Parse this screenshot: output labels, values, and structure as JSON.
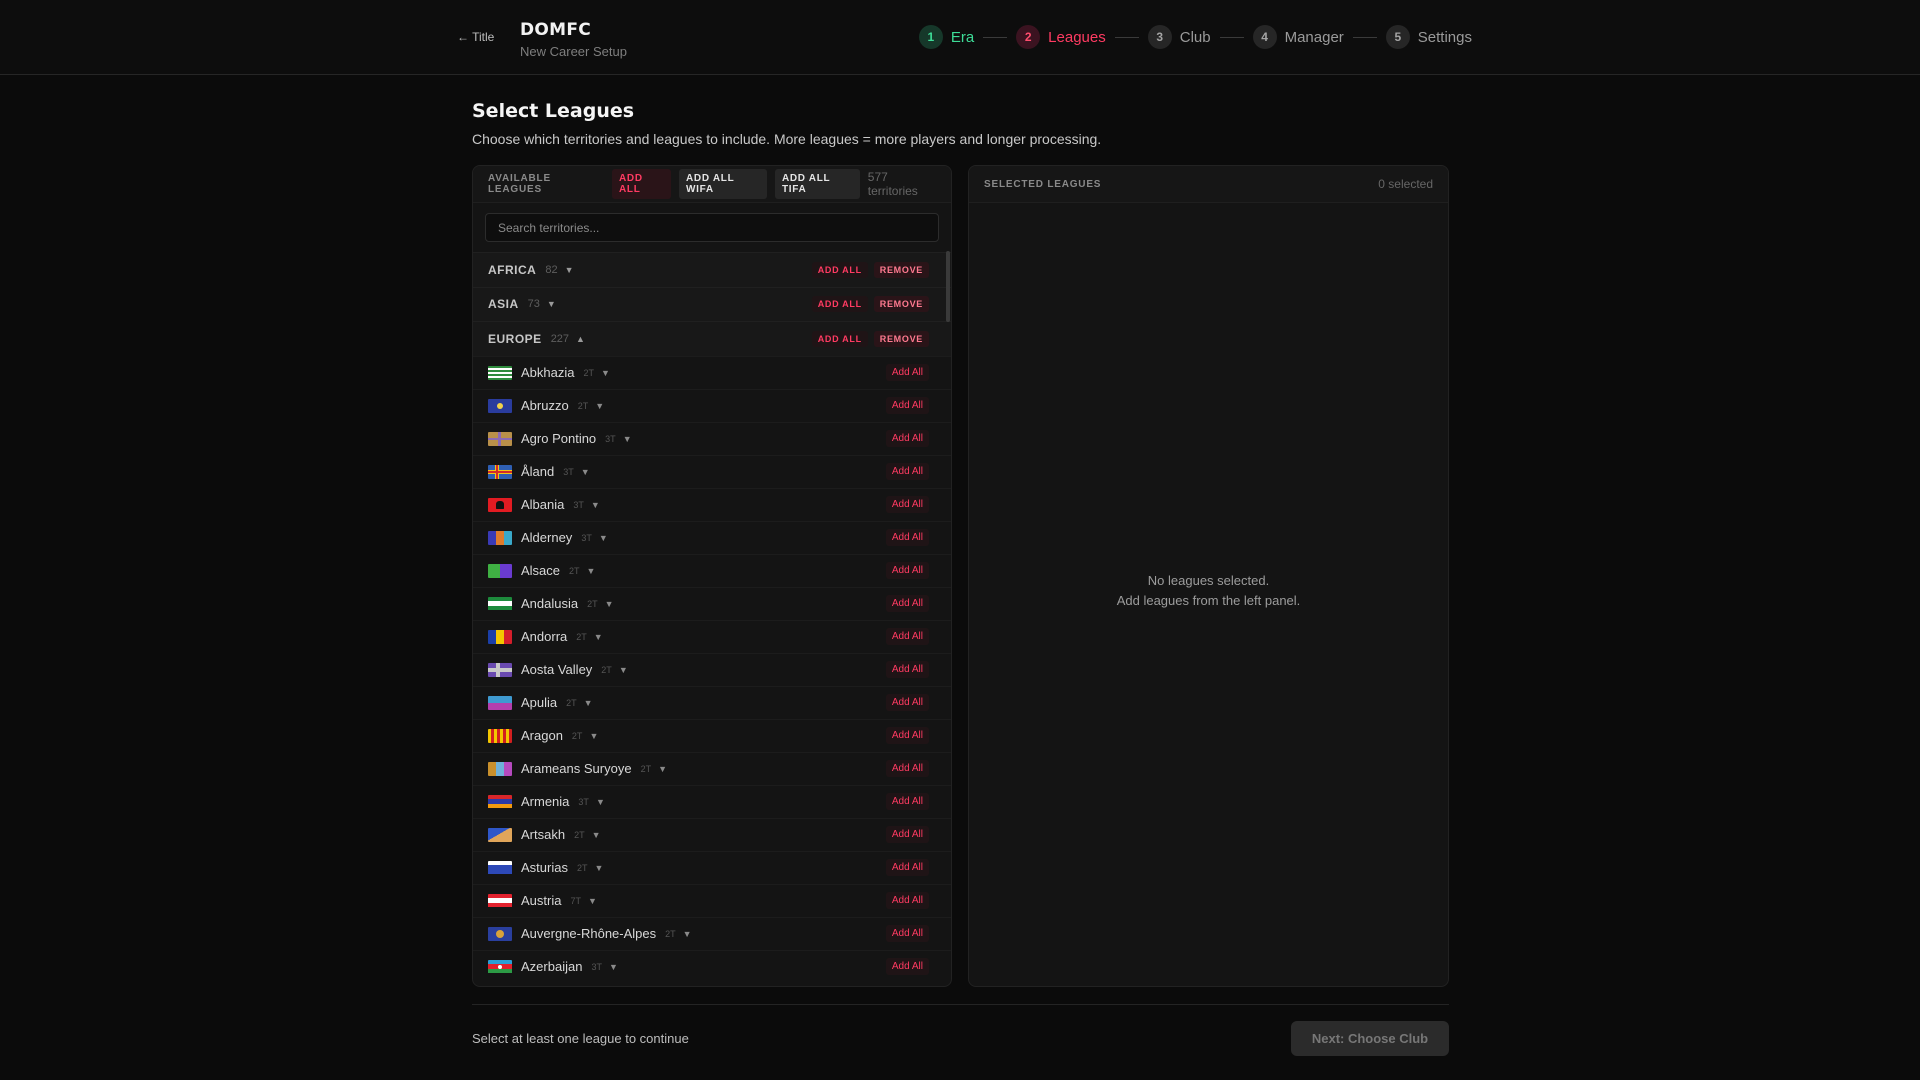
{
  "header": {
    "back_label": "← Title",
    "app_title": "DOMFC",
    "app_subtitle": "New Career Setup",
    "steps": [
      {
        "num": "1",
        "label": "Era",
        "state": "done"
      },
      {
        "num": "2",
        "label": "Leagues",
        "state": "active"
      },
      {
        "num": "3",
        "label": "Club",
        "state": "pending"
      },
      {
        "num": "4",
        "label": "Manager",
        "state": "pending"
      },
      {
        "num": "5",
        "label": "Settings",
        "state": "pending"
      }
    ]
  },
  "page": {
    "title": "Select Leagues",
    "description": "Choose which territories and leagues to include. More leagues = more players and longer processing."
  },
  "available": {
    "label": "AVAILABLE LEAGUES",
    "add_all": "ADD ALL",
    "add_all_wifa": "ADD ALL WIFA",
    "add_all_tifa": "ADD ALL TIFA",
    "territory_count": "577 territories",
    "search_placeholder": "Search territories...",
    "region_add_label": "ADD ALL",
    "region_remove_label": "REMOVE",
    "row_add_label": "Add All",
    "regions": [
      {
        "name": "AFRICA",
        "count": "82",
        "caret": "▼"
      },
      {
        "name": "ASIA",
        "count": "73",
        "caret": "▼"
      },
      {
        "name": "EUROPE",
        "count": "227",
        "caret": "▲"
      }
    ],
    "territories": [
      {
        "name": "Abkhazia",
        "tiers": "2T",
        "flag": "abkhazia"
      },
      {
        "name": "Abruzzo",
        "tiers": "2T",
        "flag": "abruzzo"
      },
      {
        "name": "Agro Pontino",
        "tiers": "3T",
        "flag": "agro"
      },
      {
        "name": "Åland",
        "tiers": "3T",
        "flag": "aland"
      },
      {
        "name": "Albania",
        "tiers": "3T",
        "flag": "albania"
      },
      {
        "name": "Alderney",
        "tiers": "3T",
        "flag": "alderney"
      },
      {
        "name": "Alsace",
        "tiers": "2T",
        "flag": "alsace"
      },
      {
        "name": "Andalusia",
        "tiers": "2T",
        "flag": "andalusia"
      },
      {
        "name": "Andorra",
        "tiers": "2T",
        "flag": "andorra"
      },
      {
        "name": "Aosta Valley",
        "tiers": "2T",
        "flag": "aosta"
      },
      {
        "name": "Apulia",
        "tiers": "2T",
        "flag": "apulia"
      },
      {
        "name": "Aragon",
        "tiers": "2T",
        "flag": "aragon"
      },
      {
        "name": "Arameans Suryoye",
        "tiers": "2T",
        "flag": "arameans"
      },
      {
        "name": "Armenia",
        "tiers": "3T",
        "flag": "armenia"
      },
      {
        "name": "Artsakh",
        "tiers": "2T",
        "flag": "artsakh"
      },
      {
        "name": "Asturias",
        "tiers": "2T",
        "flag": "asturias"
      },
      {
        "name": "Austria",
        "tiers": "7T",
        "flag": "austria"
      },
      {
        "name": "Auvergne-Rhône-Alpes",
        "tiers": "2T",
        "flag": "auvergne"
      },
      {
        "name": "Azerbaijan",
        "tiers": "3T",
        "flag": "azerbaijan"
      }
    ]
  },
  "selected": {
    "label": "SELECTED LEAGUES",
    "count": "0 selected",
    "empty_line1": "No leagues selected.",
    "empty_line2": "Add leagues from the left panel."
  },
  "footer": {
    "message": "Select at least one league to continue",
    "next_label": "Next: Choose Club"
  },
  "colors": {
    "accent_red": "#ff3b62",
    "done_green": "#3ddc97",
    "background": "#0b0b0b",
    "panel": "#141414"
  }
}
